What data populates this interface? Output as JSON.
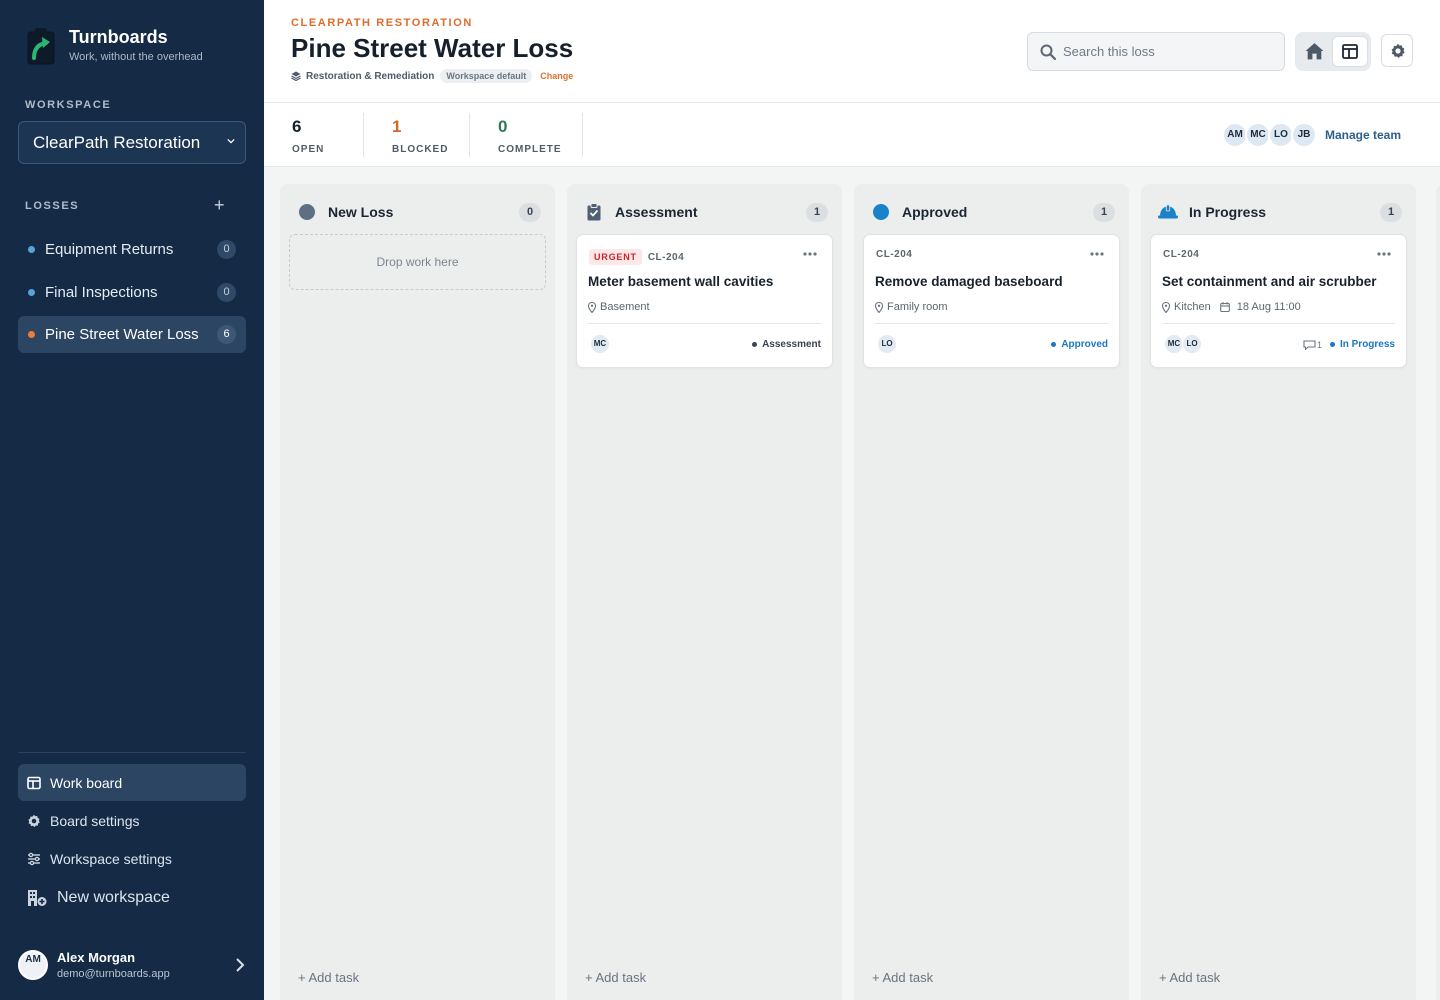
{
  "brand": {
    "name": "Turnboards",
    "tagline": "Work, without the overhead"
  },
  "sidebar": {
    "workspace_label": "WORKSPACE",
    "workspace_selected": "ClearPath Restoration",
    "losses_label": "LOSSES",
    "losses": [
      {
        "label": "Equipment Returns",
        "count": "0"
      },
      {
        "label": "Final Inspections",
        "count": "0"
      },
      {
        "label": "Pine Street Water Loss",
        "count": "6",
        "active": true
      }
    ],
    "nav": [
      {
        "label": "Work board",
        "icon": "board-icon"
      },
      {
        "label": "Board settings",
        "icon": "gear-icon"
      },
      {
        "label": "Workspace settings",
        "icon": "sliders-icon"
      },
      {
        "label": "New workspace",
        "icon": "building-add-icon"
      }
    ],
    "user": {
      "initials": "AM",
      "name": "Alex Morgan",
      "email": "demo@turnboards.app"
    }
  },
  "header": {
    "eyebrow": "CLEARPATH RESTORATION",
    "title": "Pine Street Water Loss",
    "template": "Restoration & Remediation",
    "template_pill": "Workspace default",
    "change": "Change",
    "search_placeholder": "Search this loss"
  },
  "stats": [
    {
      "value": "6",
      "label": "OPEN",
      "color": "#16202c"
    },
    {
      "value": "1",
      "label": "BLOCKED",
      "color": "#d06a2c"
    },
    {
      "value": "0",
      "label": "COMPLETE",
      "color": "#2f7a55"
    }
  ],
  "team": {
    "members": [
      "AM",
      "MC",
      "LO",
      "JB"
    ],
    "manage": "Manage team"
  },
  "board": {
    "add_task": "+ Add task",
    "drop_hint": "Drop work here",
    "columns": [
      {
        "title": "New Loss",
        "count": "0",
        "icon": "circle-icon",
        "color": "#5d7083"
      },
      {
        "title": "Assessment",
        "count": "1",
        "icon": "clipboard-check-icon",
        "color": "#4e6073",
        "card": {
          "badge": "URGENT",
          "id": "CL-204",
          "title": "Meter basement wall cavities",
          "location": "Basement",
          "date": "",
          "avatars": [
            "MC"
          ],
          "comments": "",
          "status": "Assessment"
        }
      },
      {
        "title": "Approved",
        "count": "1",
        "icon": "circle-filled-icon",
        "color": "#1a82c9",
        "card": {
          "badge": "",
          "id": "CL-204",
          "title": "Remove damaged baseboard",
          "location": "Family room",
          "date": "",
          "avatars": [
            "LO"
          ],
          "comments": "",
          "status": "Approved"
        }
      },
      {
        "title": "In Progress",
        "count": "1",
        "icon": "hard-hat-icon",
        "color": "#1a82c9",
        "card": {
          "badge": "",
          "id": "CL-204",
          "title": "Set containment and air scrubber",
          "location": "Kitchen",
          "date": "18 Aug 11:00",
          "avatars": [
            "MC",
            "LO"
          ],
          "comments": "1",
          "status": "In Progress"
        }
      }
    ]
  }
}
